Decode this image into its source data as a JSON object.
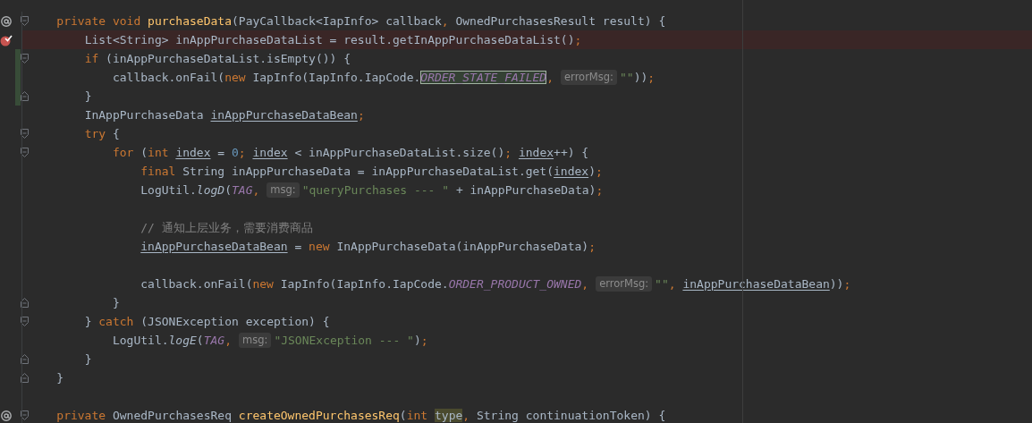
{
  "editor": {
    "lines": [
      {
        "override": true,
        "fold_start": true,
        "changed": false,
        "tokens": [
          {
            "t": "    private void ",
            "kind": "kw"
          },
          {
            "t": "purchaseData",
            "kind": "decl"
          },
          {
            "t": "(PayCallback<IapInfo> callback",
            "kind": "id"
          },
          {
            "t": ",",
            "kind": "punct"
          },
          {
            "t": " OwnedPurchasesResult result) {",
            "kind": "id"
          }
        ]
      },
      {
        "breakpoint": true,
        "changed": false,
        "tokens": [
          {
            "t": "        List<String> inAppPurchaseDataList = result.getInAppPurchaseDataList()",
            "kind": "id"
          },
          {
            "t": ";",
            "kind": "punct"
          }
        ]
      },
      {
        "fold_start": true,
        "changed": true,
        "tokens": [
          {
            "t": "        if",
            "kind": "kw"
          },
          {
            "t": " (inAppPurchaseDataList.isEmpty()) {",
            "kind": "id"
          }
        ]
      },
      {
        "changed": true,
        "tokens": [
          {
            "t": "            callback.onFail(",
            "kind": "id"
          },
          {
            "t": "new",
            "kind": "kw"
          },
          {
            "t": " IapInfo(IapInfo.IapCode.",
            "kind": "id"
          },
          {
            "t": "ORDER_STATE_FAILED",
            "kind": "boxed"
          },
          {
            "t": ",",
            "kind": "punct"
          },
          {
            "t": "errorMsg:",
            "kind": "hint"
          },
          {
            "t": "\"\"",
            "kind": "str"
          },
          {
            "t": "))",
            "kind": "id"
          },
          {
            "t": ";",
            "kind": "punct"
          }
        ]
      },
      {
        "fold_end": true,
        "changed": true,
        "tokens": [
          {
            "t": "        }",
            "kind": "id"
          }
        ]
      },
      {
        "changed": false,
        "tokens": [
          {
            "t": "        InAppPurchaseData ",
            "kind": "id"
          },
          {
            "t": "inAppPurchaseDataBean",
            "kind": "var"
          },
          {
            "t": ";",
            "kind": "punct"
          }
        ]
      },
      {
        "fold_start": true,
        "changed": false,
        "tokens": [
          {
            "t": "        try",
            "kind": "kw"
          },
          {
            "t": " {",
            "kind": "id"
          }
        ]
      },
      {
        "fold_start": true,
        "changed": false,
        "tokens": [
          {
            "t": "            for",
            "kind": "kw"
          },
          {
            "t": " (",
            "kind": "id"
          },
          {
            "t": "int ",
            "kind": "kw"
          },
          {
            "t": "index",
            "kind": "var"
          },
          {
            "t": " = ",
            "kind": "id"
          },
          {
            "t": "0",
            "kind": "num"
          },
          {
            "t": "; ",
            "kind": "punct"
          },
          {
            "t": "index",
            "kind": "var"
          },
          {
            "t": " < inAppPurchaseDataList.size()",
            "kind": "id"
          },
          {
            "t": "; ",
            "kind": "punct"
          },
          {
            "t": "index",
            "kind": "var"
          },
          {
            "t": "++) {",
            "kind": "id"
          }
        ]
      },
      {
        "changed": false,
        "tokens": [
          {
            "t": "                final",
            "kind": "kw"
          },
          {
            "t": " String inAppPurchaseData = inAppPurchaseDataList.get(",
            "kind": "id"
          },
          {
            "t": "index",
            "kind": "var"
          },
          {
            "t": ")",
            "kind": "id"
          },
          {
            "t": ";",
            "kind": "punct"
          }
        ]
      },
      {
        "changed": false,
        "tokens": [
          {
            "t": "                LogUtil.",
            "kind": "id"
          },
          {
            "t": "logD",
            "kind": "smethod"
          },
          {
            "t": "(",
            "kind": "id"
          },
          {
            "t": "TAG",
            "kind": "const"
          },
          {
            "t": ",",
            "kind": "punct"
          },
          {
            "t": "msg:",
            "kind": "hint"
          },
          {
            "t": "\"queryPurchases --- \"",
            "kind": "str"
          },
          {
            "t": " + inAppPurchaseData)",
            "kind": "id"
          },
          {
            "t": ";",
            "kind": "punct"
          }
        ]
      },
      {
        "changed": false
      },
      {
        "changed": false,
        "tokens": [
          {
            "t": "                // 通知上层业务，需要消费商品",
            "kind": "cmt"
          }
        ]
      },
      {
        "changed": false,
        "tokens": [
          {
            "t": "                inAppPurchaseDataBean",
            "kind": "var"
          },
          {
            "t": " = ",
            "kind": "id"
          },
          {
            "t": "new",
            "kind": "kw"
          },
          {
            "t": " InAppPurchaseData(inAppPurchaseData)",
            "kind": "id"
          },
          {
            "t": ";",
            "kind": "punct"
          }
        ]
      },
      {
        "changed": false
      },
      {
        "changed": false,
        "tokens": [
          {
            "t": "                callback.onFail(",
            "kind": "id"
          },
          {
            "t": "new",
            "kind": "kw"
          },
          {
            "t": " IapInfo(IapInfo.IapCode.",
            "kind": "id"
          },
          {
            "t": "ORDER_PRODUCT_OWNED",
            "kind": "const"
          },
          {
            "t": ",",
            "kind": "punct"
          },
          {
            "t": "errorMsg:",
            "kind": "hint"
          },
          {
            "t": "\"\"",
            "kind": "str"
          },
          {
            "t": ", ",
            "kind": "punct"
          },
          {
            "t": "inAppPurchaseDataBean",
            "kind": "var"
          },
          {
            "t": "))",
            "kind": "id"
          },
          {
            "t": ";",
            "kind": "punct"
          }
        ]
      },
      {
        "fold_end": true,
        "changed": false,
        "tokens": [
          {
            "t": "            }",
            "kind": "id"
          }
        ]
      },
      {
        "fold_start": true,
        "changed": false,
        "tokens": [
          {
            "t": "        } ",
            "kind": "id"
          },
          {
            "t": "catch",
            "kind": "kw"
          },
          {
            "t": " (JSONException exception) {",
            "kind": "id"
          }
        ]
      },
      {
        "changed": false,
        "tokens": [
          {
            "t": "            LogUtil.",
            "kind": "id"
          },
          {
            "t": "logE",
            "kind": "smethod"
          },
          {
            "t": "(",
            "kind": "id"
          },
          {
            "t": "TAG",
            "kind": "const"
          },
          {
            "t": ",",
            "kind": "punct"
          },
          {
            "t": "msg:",
            "kind": "hint"
          },
          {
            "t": "\"JSONException --- \"",
            "kind": "str"
          },
          {
            "t": ")",
            "kind": "id"
          },
          {
            "t": ";",
            "kind": "punct"
          }
        ]
      },
      {
        "fold_end": true,
        "changed": false,
        "tokens": [
          {
            "t": "        }",
            "kind": "id"
          }
        ]
      },
      {
        "fold_end": true,
        "changed": false,
        "tokens": [
          {
            "t": "    }",
            "kind": "id"
          }
        ]
      },
      {
        "changed": false
      },
      {
        "override": true,
        "fold_start": true,
        "changed": false,
        "tokens": [
          {
            "t": "    private ",
            "kind": "kw"
          },
          {
            "t": "OwnedPurchasesReq ",
            "kind": "id"
          },
          {
            "t": "createOwnedPurchasesReq",
            "kind": "decl"
          },
          {
            "t": "(",
            "kind": "id"
          },
          {
            "t": "int ",
            "kind": "kw"
          },
          {
            "t": "type",
            "kind": "usage"
          },
          {
            "t": ",",
            "kind": "punct"
          },
          {
            "t": " String continuationToken) {",
            "kind": "id"
          }
        ]
      }
    ]
  }
}
